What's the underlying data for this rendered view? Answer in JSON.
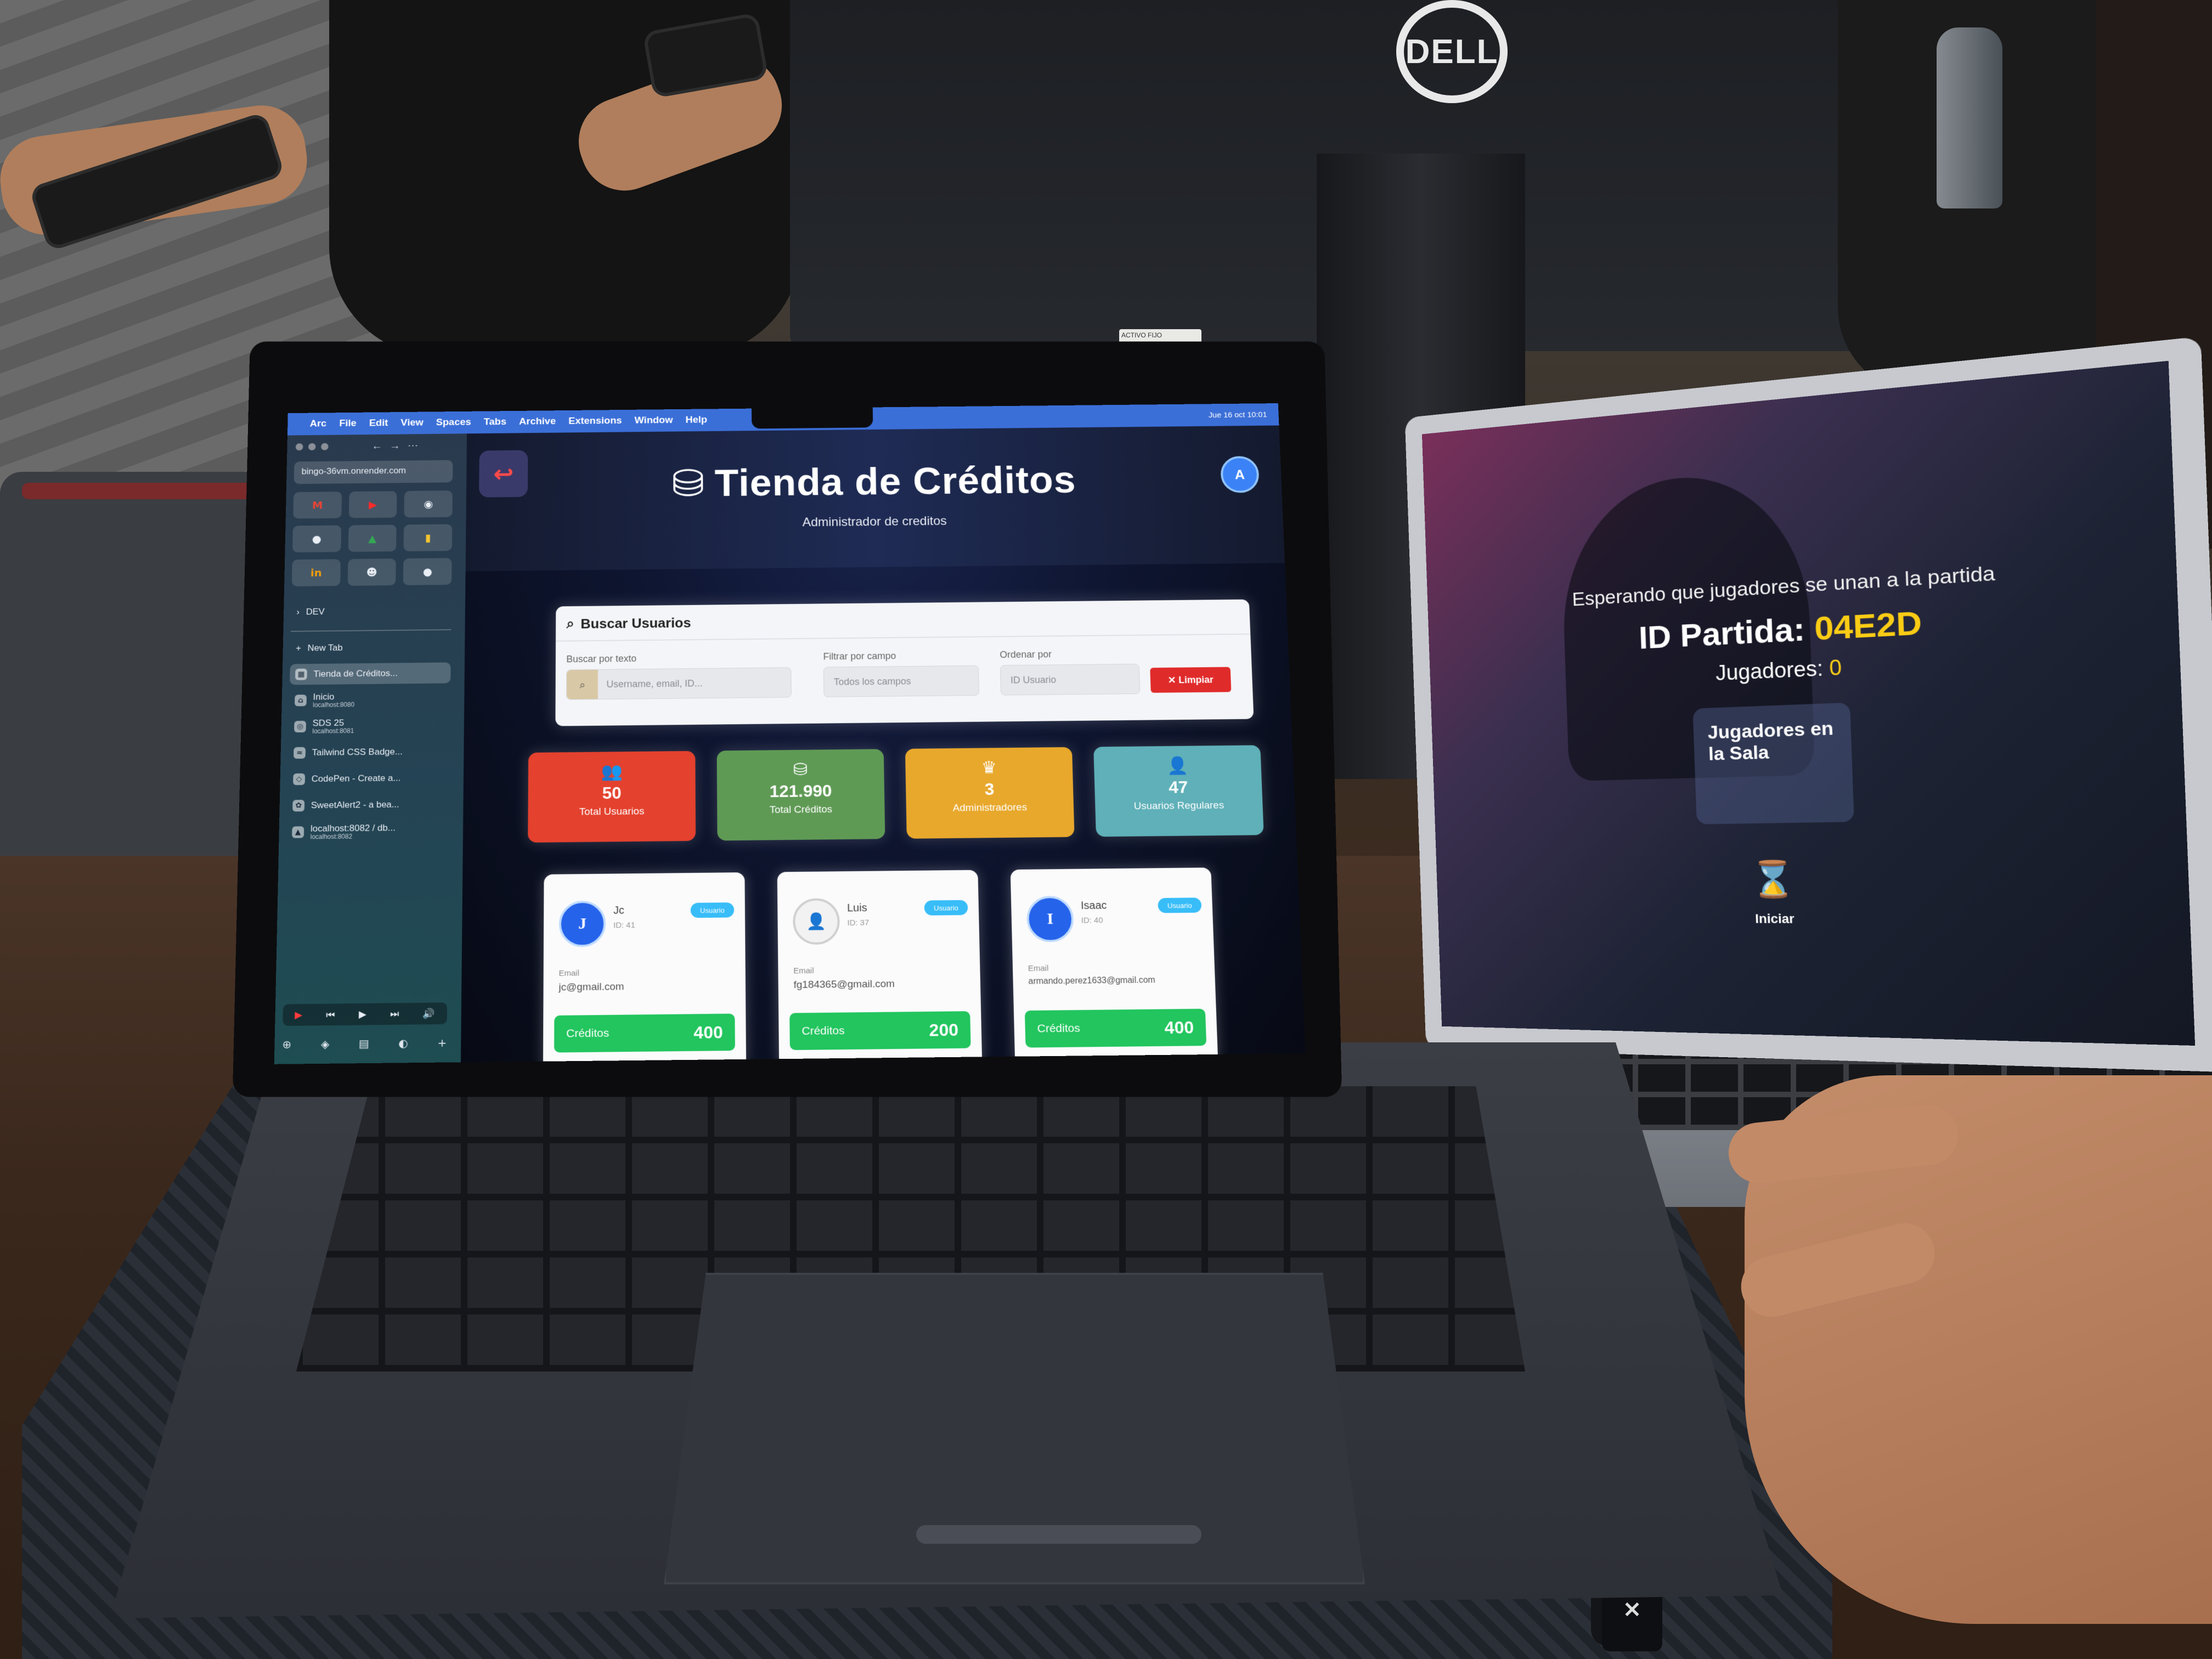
{
  "menubar": {
    "apple": "",
    "items": [
      "Arc",
      "File",
      "Edit",
      "View",
      "Spaces",
      "Tabs",
      "Archive",
      "Extensions",
      "Window",
      "Help"
    ],
    "status": "Jue 16 oct 10:01"
  },
  "sidebar": {
    "url": "bingo-36vm.onrender.com",
    "favorites": [
      "M",
      "▶",
      "◉",
      "●",
      "▲",
      "▮",
      "in",
      "☻",
      "●"
    ],
    "folder": "DEV",
    "new_tab": "New Tab",
    "tabs": [
      {
        "title": "Tienda de Créditos...",
        "sub": "",
        "icon": "▦"
      },
      {
        "title": "Inicio",
        "sub": "localhost:8080",
        "icon": "⌂"
      },
      {
        "title": "SDS 25",
        "sub": "localhost:8081",
        "icon": "◎"
      },
      {
        "title": "Tailwind CSS Badge...",
        "sub": "",
        "icon": "≈"
      },
      {
        "title": "CodePen - Create a...",
        "sub": "",
        "icon": "◇"
      },
      {
        "title": "SweetAlert2 - a bea...",
        "sub": "",
        "icon": "✿"
      },
      {
        "title": "localhost:8082 / db...",
        "sub": "localhost:8082",
        "icon": "▲"
      }
    ],
    "media_controls": [
      "▶",
      "⏮",
      "▶",
      "⏭",
      "🔊"
    ],
    "bottom_icons": [
      "⊕",
      "◈",
      "▤",
      "◐",
      "+"
    ]
  },
  "app": {
    "back_icon": "↩",
    "coin_icon": "⛁",
    "title": "Tienda de Créditos",
    "subtitle": "Administrador de creditos",
    "avatar": "A",
    "search": {
      "icon": "⌕",
      "heading": "Buscar Usuarios",
      "text_label": "Buscar por texto",
      "text_placeholder": "Username, email, ID...",
      "filter_label": "Filtrar por campo",
      "filter_value": "Todos los campos",
      "order_label": "Ordenar por",
      "order_value": "ID Usuario",
      "clear_label": "✕ Limpiar"
    },
    "stats": [
      {
        "icon": "👥",
        "value": "50",
        "label": "Total Usuarios",
        "color": "#e4412e"
      },
      {
        "icon": "⛁",
        "value": "121.990",
        "label": "Total Créditos",
        "color": "#5f9a55"
      },
      {
        "icon": "♛",
        "value": "3",
        "label": "Administradores",
        "color": "#e8a82c"
      },
      {
        "icon": "👤",
        "value": "47",
        "label": "Usuarios Regulares",
        "color": "#5fb0b8"
      }
    ],
    "users": [
      {
        "initial": "J",
        "name": "Jc",
        "id": "ID: 41",
        "role": "Usuario",
        "email_label": "Email",
        "email": "jc@gmail.com",
        "credits_label": "Créditos",
        "credits": "400"
      },
      {
        "initial": "👤",
        "name": "Luis",
        "id": "ID: 37",
        "role": "Usuario",
        "email_label": "Email",
        "email": "fg184365@gmail.com",
        "credits_label": "Créditos",
        "credits": "200"
      },
      {
        "initial": "I",
        "name": "Isaac",
        "id": "ID: 40",
        "role": "Usuario",
        "email_label": "Email",
        "email": "armando.perez1633@gmail.com",
        "credits_label": "Créditos",
        "credits": "400"
      }
    ]
  },
  "right_screen": {
    "waiting": "Esperando que jugadores se unan a la partida",
    "id_label": "ID Partida:",
    "id_value": "04E2D",
    "players_label": "Jugadores:",
    "players_value": "0",
    "room_title": "Jugadores en la Sala",
    "hourglass_icon": "⌛",
    "start_label": "Iniciar"
  },
  "scene": {
    "monitor_brand": "DELL",
    "asset_tag": "ACTIVO FIJO",
    "zip_logo": "✕"
  }
}
